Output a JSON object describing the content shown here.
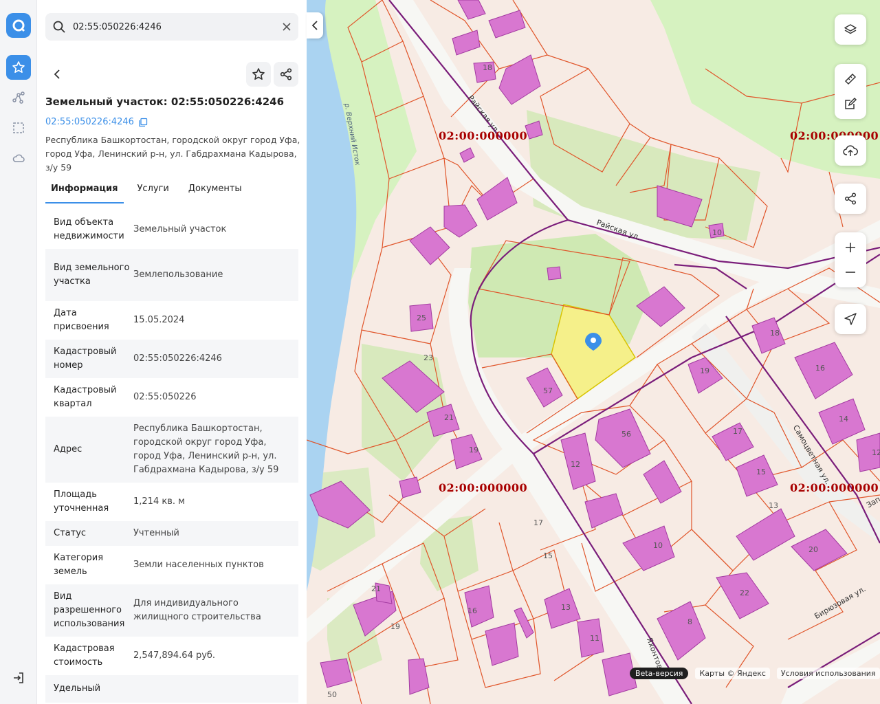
{
  "search": {
    "value": "02:55:050226:4246"
  },
  "parcel": {
    "title": "Земельный участок: 02:55:050226:4246",
    "cad_link": "02:55:050226:4246",
    "address": "Республика Башкортостан, городской округ город Уфа, город Уфа, Ленинский р-н, ул. Габдрахмана Кадырова, з/у 59"
  },
  "tabs": [
    {
      "label": "Информация",
      "active": true
    },
    {
      "label": "Услуги",
      "active": false
    },
    {
      "label": "Документы",
      "active": false
    }
  ],
  "rows": [
    {
      "k": "Вид объекта недвижимости",
      "v": "Земельный участок"
    },
    {
      "k": "Вид земельного участка",
      "v": "Землепользование"
    },
    {
      "k": "Дата присвоения",
      "v": "15.05.2024"
    },
    {
      "k": "Кадастровый номер",
      "v": "02:55:050226:4246"
    },
    {
      "k": "Кадастровый квартал",
      "v": "02:55:050226"
    },
    {
      "k": "Адрес",
      "v": "Республика Башкортостан, городской округ город Уфа, город Уфа, Ленинский р-н, ул. Габдрахмана Кадырова, з/у 59"
    },
    {
      "k": "Площадь уточненная",
      "v": "1,214 кв. м"
    },
    {
      "k": "Статус",
      "v": "Учтенный"
    },
    {
      "k": "Категория земель",
      "v": "Земли населенных пунктов"
    },
    {
      "k": "Вид разрешенного использования",
      "v": "Для индивидуального жилищного строительства"
    },
    {
      "k": "Кадастровая стоимость",
      "v": "2,547,894.64 руб."
    },
    {
      "k": "Удельный",
      "v": ""
    }
  ],
  "map": {
    "cadastral_labels": [
      "02:00:000000",
      "02:00:000000",
      "02:00:000000",
      "02:00:000000"
    ],
    "streets": {
      "rayskaya_1": "Райская ул.",
      "rayskaya_2": "Райская ул.",
      "samotsvetnaya": "Самоцветная ул.",
      "biryuzovaya": "Бирюзовая ул.",
      "yakhontovaya": "Яхонтовая",
      "zap": "Зап"
    },
    "river": "р. Верхний Исток",
    "house_numbers": [
      "18",
      "10",
      "25",
      "23",
      "57",
      "21",
      "19",
      "56",
      "12",
      "19",
      "17",
      "15",
      "18",
      "16",
      "14",
      "12",
      "13",
      "10",
      "20",
      "22",
      "8",
      "17",
      "15",
      "21",
      "19",
      "16",
      "13",
      "11",
      "50"
    ],
    "attribution": {
      "beta": "Beta-версия",
      "maps": "Карты © Яндекс",
      "terms": "Условия использования"
    }
  },
  "colors": {
    "accent": "#3b8fe8",
    "parcel_line": "#e0552a",
    "building": "#d877d0",
    "selected": "#f5f08a",
    "boundary": "#7a1d7a",
    "cad_label": "#a80000"
  },
  "icons": [
    "search-icon",
    "close-icon",
    "chevron-left-icon",
    "star-icon",
    "share-icon",
    "copy-icon",
    "logo-icon",
    "route-icon",
    "select-area-icon",
    "cloud-icon",
    "logout-icon",
    "layers-icon",
    "ruler-icon",
    "edit-icon",
    "upload-icon",
    "zoom-in-icon",
    "zoom-out-icon",
    "locate-icon",
    "map-pin-icon"
  ]
}
